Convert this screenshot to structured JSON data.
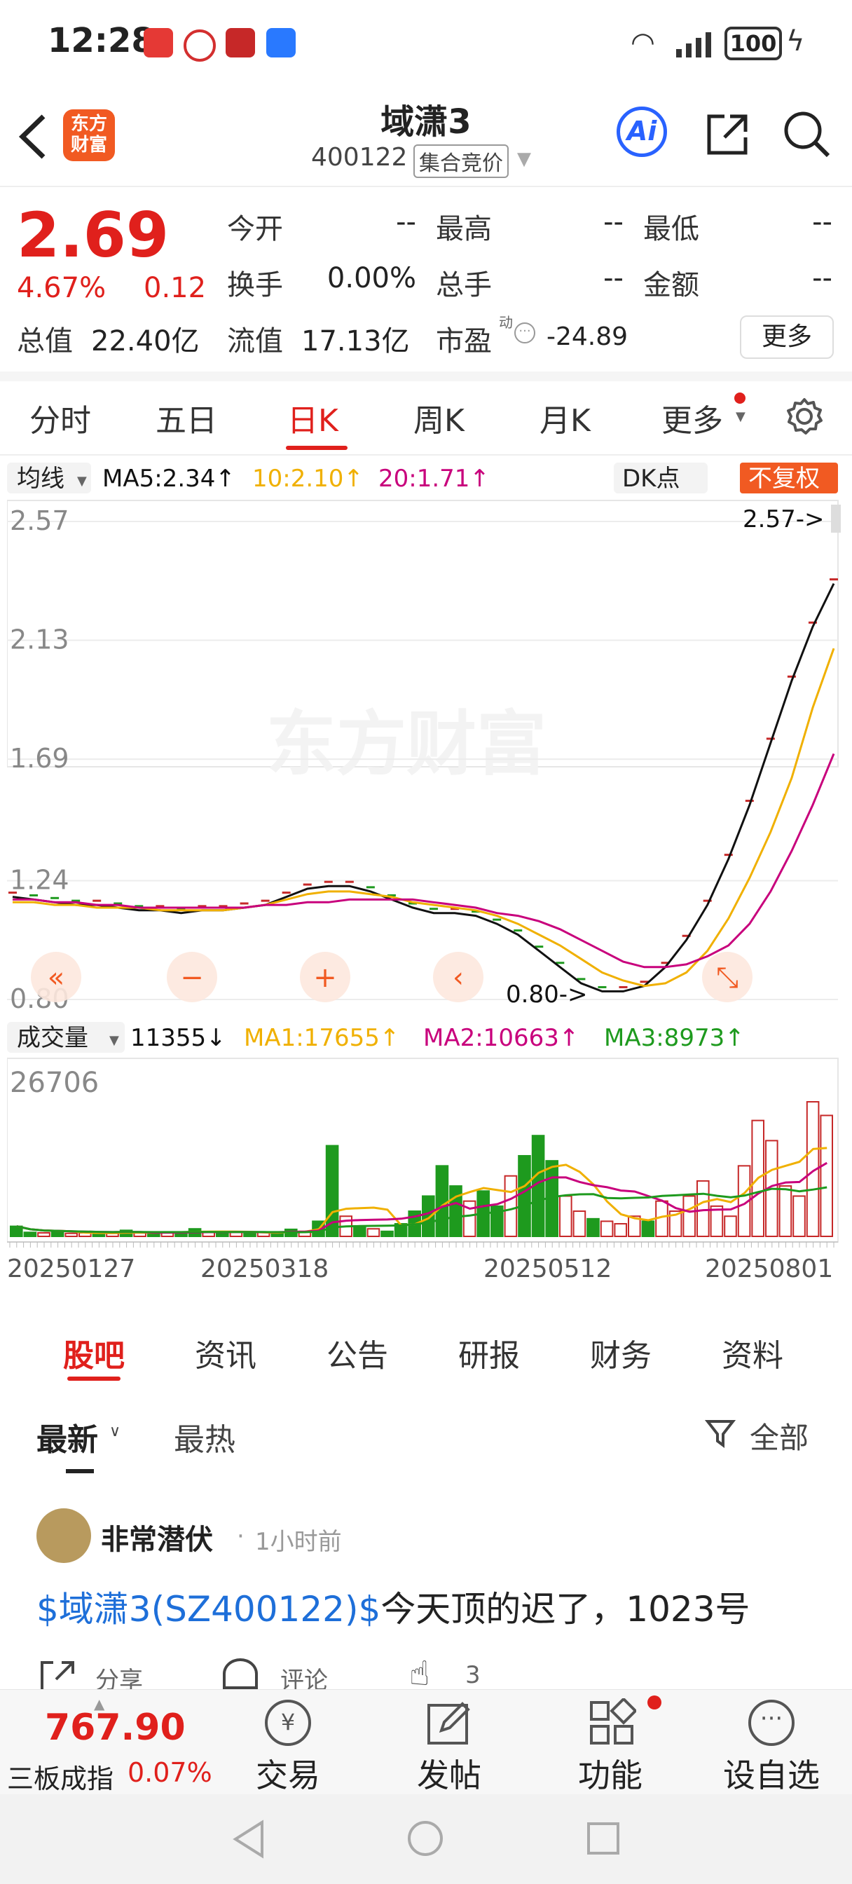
{
  "status_bar": {
    "time": "12:28",
    "battery": "100"
  },
  "header": {
    "title": "域潇3",
    "code": "400122",
    "auction_badge": "集合竞价",
    "logo_text_1": "东方",
    "logo_text_2": "财富"
  },
  "quote": {
    "price": "2.69",
    "change_pct": "4.67%",
    "change": "0.12",
    "open_label": "今开",
    "open": "--",
    "high_label": "最高",
    "high": "--",
    "low_label": "最低",
    "low": "--",
    "turnover_label": "换手",
    "turnover": "0.00%",
    "volume_label": "总手",
    "volume": "--",
    "amount_label": "金额",
    "amount": "--",
    "mktcap_label": "总值",
    "mktcap": "22.40亿",
    "float_label": "流值",
    "float": "17.13亿",
    "pe_label": "市盈",
    "pe_sup": "动",
    "pe": "-24.89",
    "more_button": "更多"
  },
  "chart_tabs": [
    "分时",
    "五日",
    "日K",
    "周K",
    "月K",
    "更多"
  ],
  "chart_tab_active": 2,
  "ma_bar": {
    "selector": "均线",
    "ma5": "MA5:2.34↑",
    "ma10": "10:2.10↑",
    "ma20": "20:1.71↑",
    "dk": "DK点",
    "fuquan": "不复权"
  },
  "colors": {
    "accent": "#e0201c",
    "ma5": "#111111",
    "ma10": "#f0b000",
    "ma20": "#c8007c",
    "up": "#c62828",
    "down": "#1e9a1e",
    "brand": "#f15a22"
  },
  "vol_bar": {
    "selector": "成交量",
    "vol": "11355↓",
    "ma1": "MA1:17655↑",
    "ma2": "MA2:10663↑",
    "ma3": "MA3:8973↑"
  },
  "chart_data": [
    {
      "type": "line",
      "y_ticks": [
        "2.57",
        "2.13",
        "1.69",
        "1.24",
        "0.80"
      ],
      "ylim": [
        0.8,
        2.57
      ],
      "max_label": "2.57->",
      "min_label": "0.80->",
      "watermark": "东方财富",
      "controls": [
        "«",
        "−",
        "+",
        "‹",
        "⤡"
      ],
      "series": [
        {
          "name": "MA5",
          "values": [
            1.18,
            1.17,
            1.16,
            1.15,
            1.15,
            1.14,
            1.13,
            1.13,
            1.12,
            1.13,
            1.13,
            1.14,
            1.15,
            1.18,
            1.21,
            1.22,
            1.22,
            1.2,
            1.17,
            1.14,
            1.12,
            1.12,
            1.11,
            1.08,
            1.04,
            0.98,
            0.92,
            0.86,
            0.83,
            0.83,
            0.85,
            0.92,
            1.02,
            1.15,
            1.32,
            1.52,
            1.75,
            1.98,
            2.18,
            2.34
          ]
        },
        {
          "name": "10",
          "values": [
            1.16,
            1.16,
            1.15,
            1.15,
            1.14,
            1.14,
            1.14,
            1.13,
            1.13,
            1.13,
            1.13,
            1.14,
            1.15,
            1.17,
            1.19,
            1.2,
            1.2,
            1.19,
            1.18,
            1.16,
            1.15,
            1.14,
            1.13,
            1.11,
            1.08,
            1.04,
            1.0,
            0.95,
            0.9,
            0.87,
            0.85,
            0.86,
            0.9,
            0.98,
            1.1,
            1.25,
            1.42,
            1.62,
            1.88,
            2.1
          ]
        },
        {
          "name": "20",
          "values": [
            1.17,
            1.17,
            1.16,
            1.16,
            1.15,
            1.15,
            1.14,
            1.14,
            1.14,
            1.14,
            1.14,
            1.14,
            1.15,
            1.15,
            1.16,
            1.16,
            1.17,
            1.17,
            1.17,
            1.17,
            1.16,
            1.15,
            1.14,
            1.12,
            1.11,
            1.09,
            1.06,
            1.02,
            0.98,
            0.94,
            0.92,
            0.92,
            0.93,
            0.96,
            1.0,
            1.08,
            1.2,
            1.35,
            1.52,
            1.71
          ]
        }
      ]
    },
    {
      "type": "bar",
      "ymax_label": "26706",
      "ylim": [
        0,
        26706
      ],
      "x_ticks": [
        "20250127",
        "20250318",
        "20250512",
        "20250801"
      ],
      "values": [
        2000,
        800,
        700,
        900,
        600,
        700,
        500,
        600,
        1200,
        700,
        600,
        900,
        800,
        1500,
        900,
        700,
        800,
        600,
        900,
        700,
        1400,
        1000,
        3000,
        18000,
        4000,
        2000,
        1500,
        1000,
        2500,
        5000,
        8000,
        14000,
        10000,
        7000,
        9000,
        6000,
        12000,
        16000,
        20000,
        15000,
        8000,
        5000,
        3500,
        3000,
        2500,
        4000,
        3000,
        7000,
        5000,
        8000,
        11000,
        6000,
        4000,
        14000,
        23000,
        19000,
        10000,
        8000,
        26706,
        24000
      ],
      "directions": [
        "d",
        "d",
        "u",
        "d",
        "u",
        "u",
        "d",
        "u",
        "d",
        "u",
        "d",
        "u",
        "d",
        "d",
        "u",
        "d",
        "u",
        "d",
        "u",
        "d",
        "d",
        "u",
        "d",
        "d",
        "u",
        "d",
        "u",
        "d",
        "d",
        "d",
        "d",
        "d",
        "d",
        "u",
        "d",
        "d",
        "u",
        "d",
        "d",
        "d",
        "u",
        "u",
        "d",
        "u",
        "u",
        "u",
        "d",
        "u",
        "u",
        "u",
        "u",
        "u",
        "u",
        "u",
        "u",
        "u",
        "u",
        "u",
        "u",
        "u"
      ]
    }
  ],
  "content_tabs": [
    "股吧",
    "资讯",
    "公告",
    "研报",
    "财务",
    "资料"
  ],
  "content_tab_active": 0,
  "feed": {
    "sort_latest": "最新",
    "sort_hot": "最热",
    "filter": "全部",
    "post": {
      "author": "非常潜伏",
      "time": "1小时前",
      "stock_link": "$域潇3(SZ400122)$",
      "text": "今天顶的迟了，1023号",
      "share": "分享",
      "comment": "评论",
      "likes": "3"
    }
  },
  "bottom_nav": {
    "index_value": "767.90",
    "index_name": "三板成指",
    "index_change": "0.07%",
    "items": [
      "交易",
      "发帖",
      "功能",
      "设自选"
    ]
  }
}
